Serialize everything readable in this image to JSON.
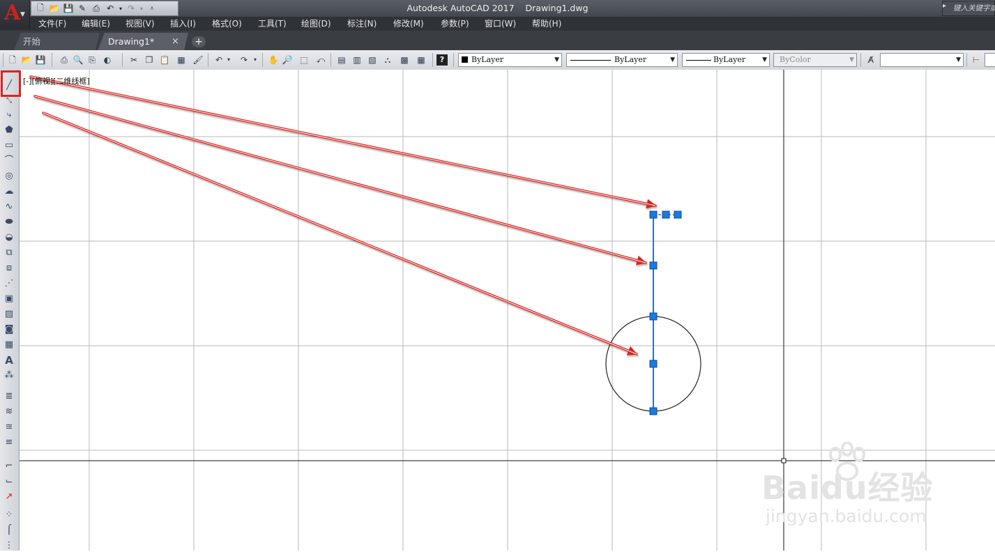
{
  "app": {
    "title": "Autodesk AutoCAD 2017",
    "filename": "Drawing1.dwg",
    "logo_letter": "A",
    "search_placeholder": "键入关键字或短语"
  },
  "quick_access": [
    "new-icon",
    "open-icon",
    "save-icon",
    "save-as-icon",
    "plot-icon",
    "undo-icon",
    "redo-icon",
    "customize-icon"
  ],
  "menu": [
    {
      "label": "文件(F)"
    },
    {
      "label": "编辑(E)"
    },
    {
      "label": "视图(V)"
    },
    {
      "label": "插入(I)"
    },
    {
      "label": "格式(O)"
    },
    {
      "label": "工具(T)"
    },
    {
      "label": "绘图(D)"
    },
    {
      "label": "标注(N)"
    },
    {
      "label": "修改(M)"
    },
    {
      "label": "参数(P)"
    },
    {
      "label": "窗口(W)"
    },
    {
      "label": "帮助(H)"
    }
  ],
  "tabs": {
    "start": "开始",
    "drawing": "Drawing1*",
    "close": "×",
    "add": "+"
  },
  "properties": {
    "color": "ByLayer",
    "linetype": "ByLayer",
    "lineweight": "ByLayer",
    "plotstyle": "ByColor"
  },
  "viewport_label": "[-][俯视][二维线框]",
  "watermark": {
    "main": "Baidu经验",
    "sub": "jingyan.baidu.com"
  },
  "colors": {
    "grip": "#1a7ae0",
    "selected_line": "#2b6fd6",
    "arrow": "#e0221e",
    "highlight": "#e0221e"
  }
}
